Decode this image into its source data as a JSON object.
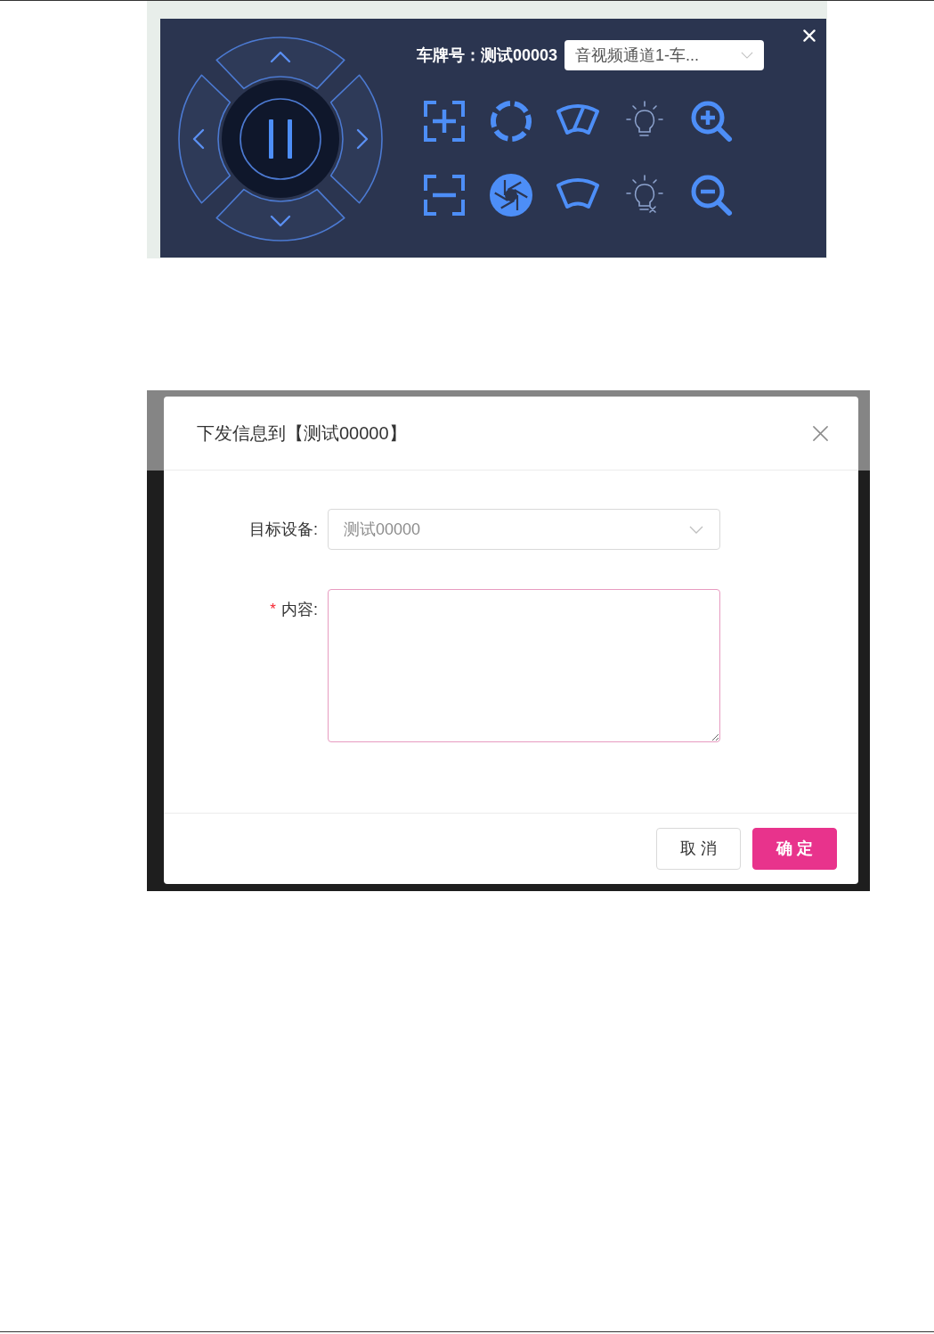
{
  "ptz_panel": {
    "plate": "车牌号：测试00003",
    "channel_select": {
      "value": "音视频通道1-车..."
    }
  },
  "message_dialog": {
    "title": "下发信息到【测试00000】",
    "fields": [
      {
        "kind": "select",
        "label": "目标设备:",
        "value": "测试00000",
        "focused": false
      },
      {
        "kind": "textarea",
        "label": "内容:",
        "required_mark": "*",
        "focused": true
      }
    ],
    "buttons": [
      {
        "kind": "default",
        "label": "取 消"
      },
      {
        "kind": "primary",
        "label": "确 定"
      }
    ]
  }
}
